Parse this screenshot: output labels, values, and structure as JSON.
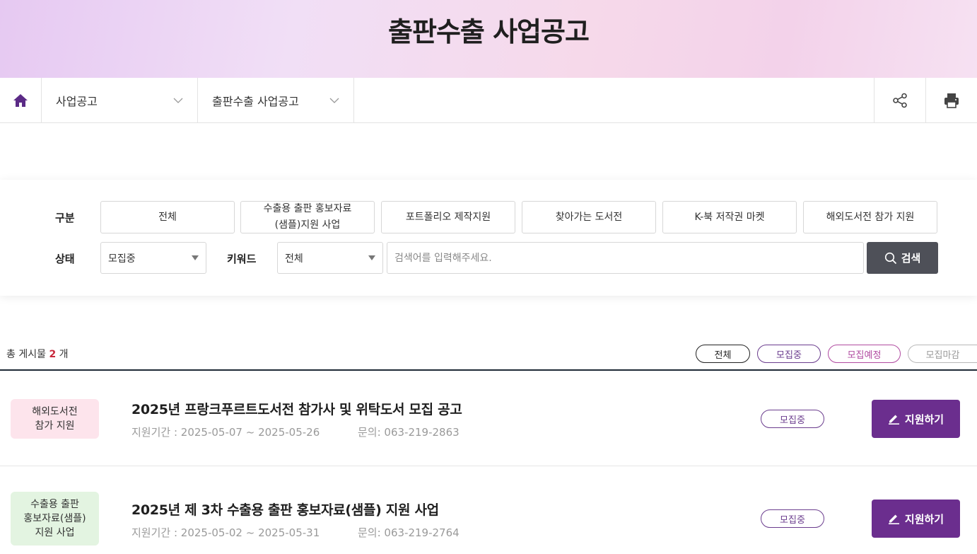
{
  "page_title": "출판수출 사업공고",
  "breadcrumb": {
    "level1": "사업공고",
    "level2": "출판수출 사업공고"
  },
  "filter": {
    "category_label": "구분",
    "categories": [
      "전체",
      "수출용 출판 홍보자료\n(샘플)지원 사업",
      "포트폴리오 제작지원",
      "찾아가는 도서전",
      "K-북 저작권 마켓",
      "해외도서전 참가 지원"
    ],
    "status_label": "상태",
    "status_value": "모집중",
    "keyword_label": "키워드",
    "keyword_value": "전체",
    "search_placeholder": "검색어를 입력해주세요.",
    "search_button": "검색"
  },
  "list": {
    "count_prefix": "총 게시물",
    "count": "2",
    "count_suffix": "개",
    "status_filters": [
      "전체",
      "모집중",
      "모집예정",
      "모집마감"
    ],
    "items": [
      {
        "tag": "해외도서전\n참가 지원",
        "title": "2025년 프랑크푸르트도서전 참가사 및 위탁도서 모집 공고",
        "period": "지원기간 : 2025-05-07 ~ 2025-05-26",
        "contact": "문의: 063-219-2863",
        "status": "모집중",
        "apply": "지원하기"
      },
      {
        "tag": "수출용 출판\n홍보자료(샘플)\n지원 사업",
        "title": "2025년 제 3차 수출용 출판 홍보자료(샘플) 지원 사업",
        "period": "지원기간 : 2025-05-02 ~ 2025-05-31",
        "contact": "문의: 063-219-2764",
        "status": "모집중",
        "apply": "지원하기"
      }
    ]
  },
  "colors": {
    "brand_purple": "#6b2e8e",
    "tag_pink_bg": "#fde4ec",
    "tag_green_bg": "#e3f4e1",
    "count_red": "#c8283c"
  },
  "icons": {
    "home": "home-icon",
    "share": "share-icon",
    "print": "print-icon",
    "search": "search-icon",
    "pencil": "pencil-icon"
  }
}
